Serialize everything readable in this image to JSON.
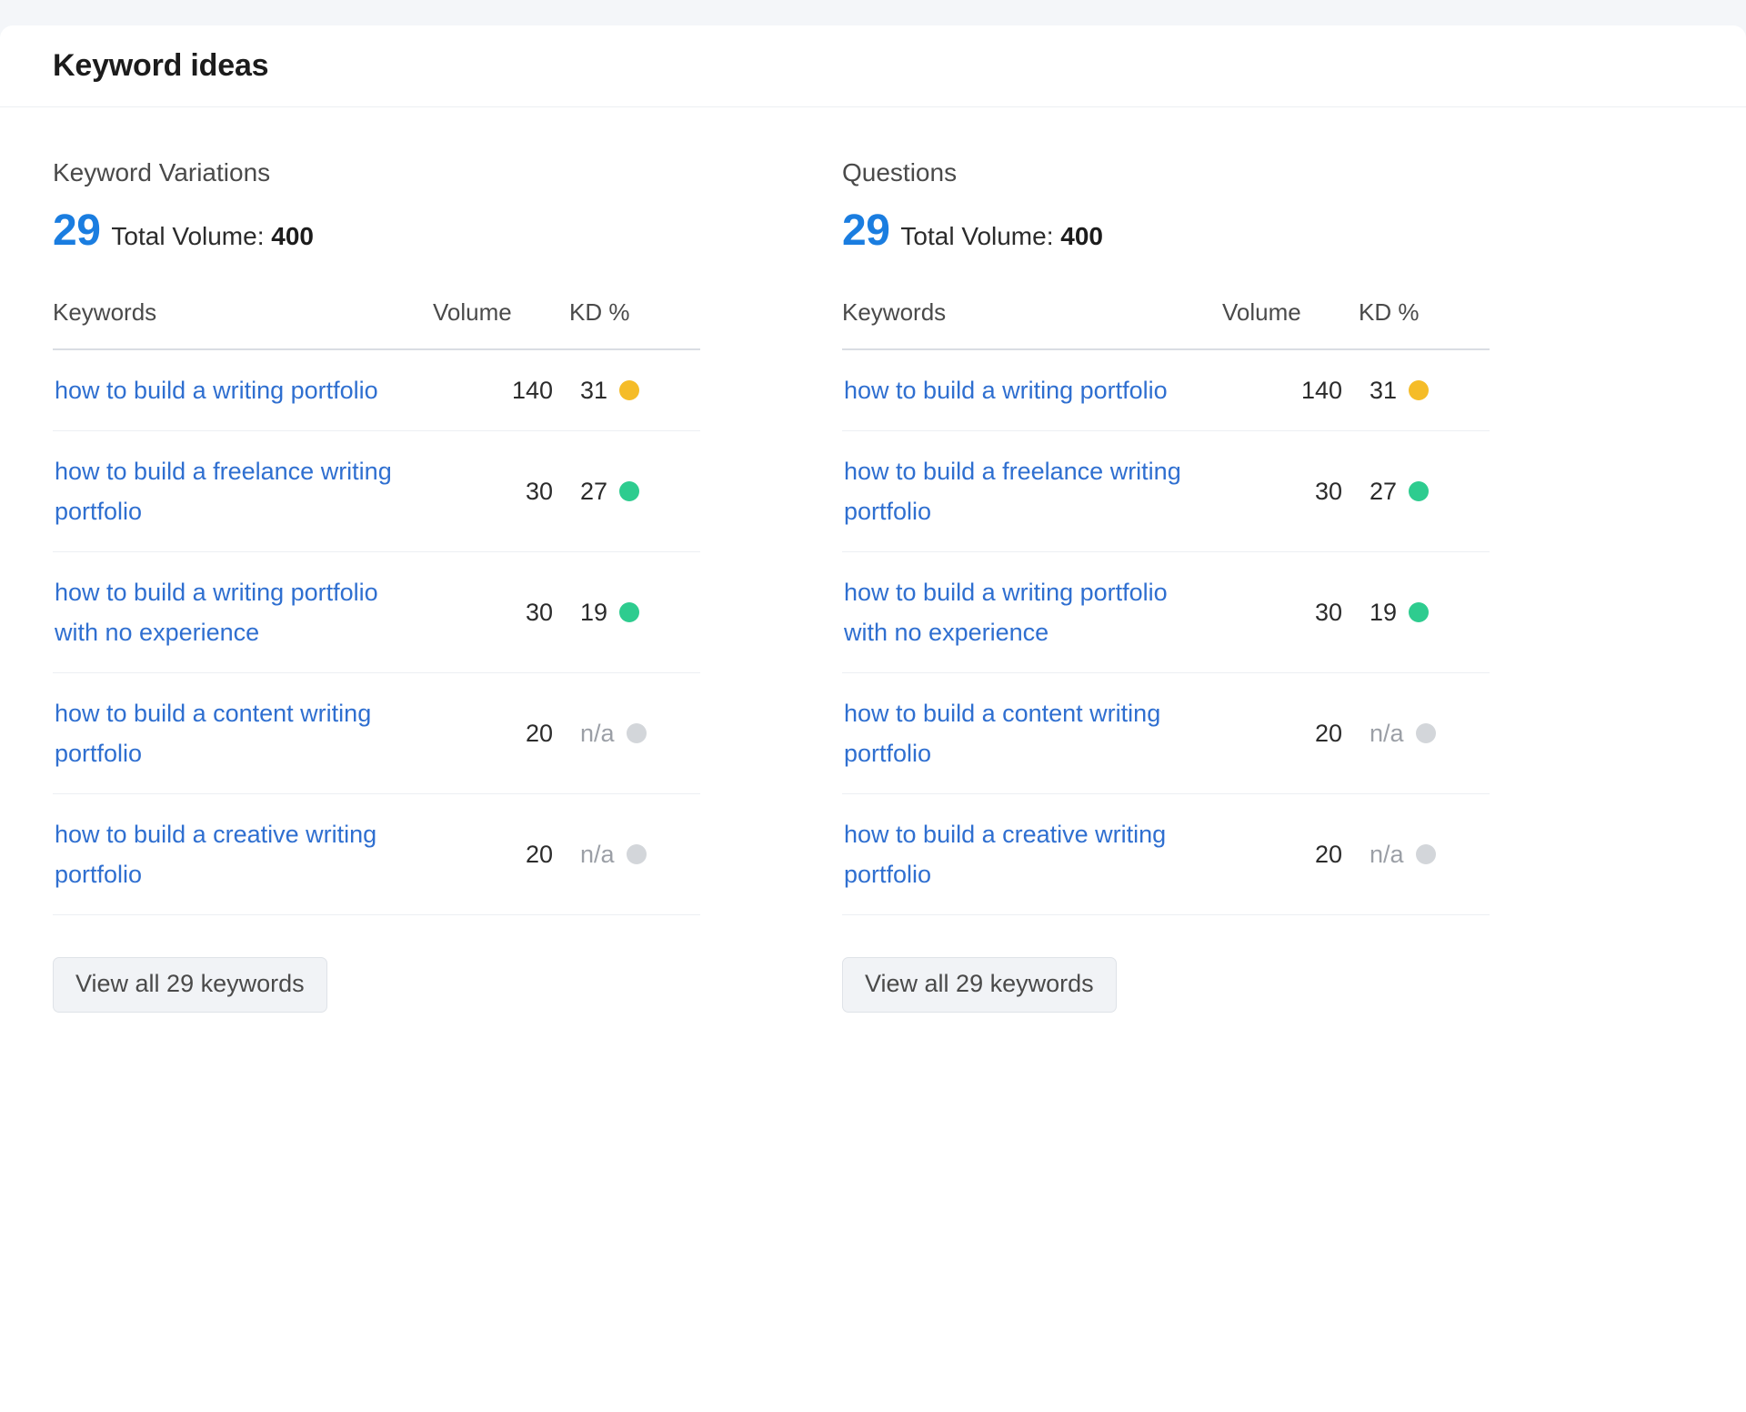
{
  "card": {
    "title": "Keyword ideas"
  },
  "colors": {
    "accent_blue": "#1a7de0",
    "link_blue": "#2f6fd0",
    "kd_easy_green": "#2ecc8f",
    "kd_medium_orange": "#f5bc28",
    "kd_na_gray": "#d3d6da",
    "page_background": "#f4f6f9",
    "card_background": "#ffffff"
  },
  "columns": [
    {
      "section_label": "Keyword Variations",
      "count": "29",
      "total_volume_label": "Total Volume:",
      "total_volume_value": "400",
      "table": {
        "headers": [
          "Keywords",
          "Volume",
          "KD %"
        ],
        "rows": [
          {
            "keyword": "how to build a writing portfolio",
            "volume": "140",
            "kd": "31",
            "kd_level": "medium"
          },
          {
            "keyword": "how to build a freelance writing portfolio",
            "volume": "30",
            "kd": "27",
            "kd_level": "easy"
          },
          {
            "keyword": "how to build a writing portfolio with no experience",
            "volume": "30",
            "kd": "19",
            "kd_level": "easy"
          },
          {
            "keyword": "how to build a content writing portfolio",
            "volume": "20",
            "kd": "n/a",
            "kd_level": "na"
          },
          {
            "keyword": "how to build a creative writing portfolio",
            "volume": "20",
            "kd": "n/a",
            "kd_level": "na"
          }
        ]
      },
      "view_all_label": "View all 29 keywords"
    },
    {
      "section_label": "Questions",
      "count": "29",
      "total_volume_label": "Total Volume:",
      "total_volume_value": "400",
      "table": {
        "headers": [
          "Keywords",
          "Volume",
          "KD %"
        ],
        "rows": [
          {
            "keyword": "how to build a writing portfolio",
            "volume": "140",
            "kd": "31",
            "kd_level": "medium"
          },
          {
            "keyword": "how to build a freelance writing portfolio",
            "volume": "30",
            "kd": "27",
            "kd_level": "easy"
          },
          {
            "keyword": "how to build a writing portfolio with no experience",
            "volume": "30",
            "kd": "19",
            "kd_level": "easy"
          },
          {
            "keyword": "how to build a content writing portfolio",
            "volume": "20",
            "kd": "n/a",
            "kd_level": "na"
          },
          {
            "keyword": "how to build a creative writing portfolio",
            "volume": "20",
            "kd": "n/a",
            "kd_level": "na"
          }
        ]
      },
      "view_all_label": "View all 29 keywords"
    }
  ]
}
